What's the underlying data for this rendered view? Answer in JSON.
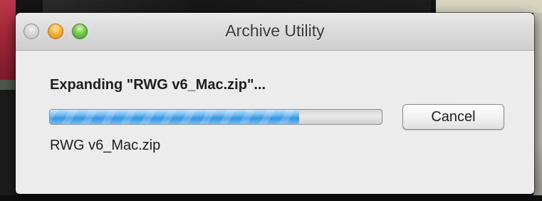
{
  "window": {
    "title": "Archive Utility"
  },
  "traffic_lights": [
    {
      "name": "close",
      "color": "#c8c8c8"
    },
    {
      "name": "minimize",
      "color": "#f5b33a"
    },
    {
      "name": "zoom",
      "color": "#77c94b"
    }
  ],
  "dialog": {
    "status_text": "Expanding \"RWG v6_Mac.zip\"...",
    "progress_fraction": 0.75,
    "cancel_label": "Cancel",
    "file_name": "RWG v6_Mac.zip"
  },
  "colors": {
    "progress_accent": "#3b93de"
  }
}
